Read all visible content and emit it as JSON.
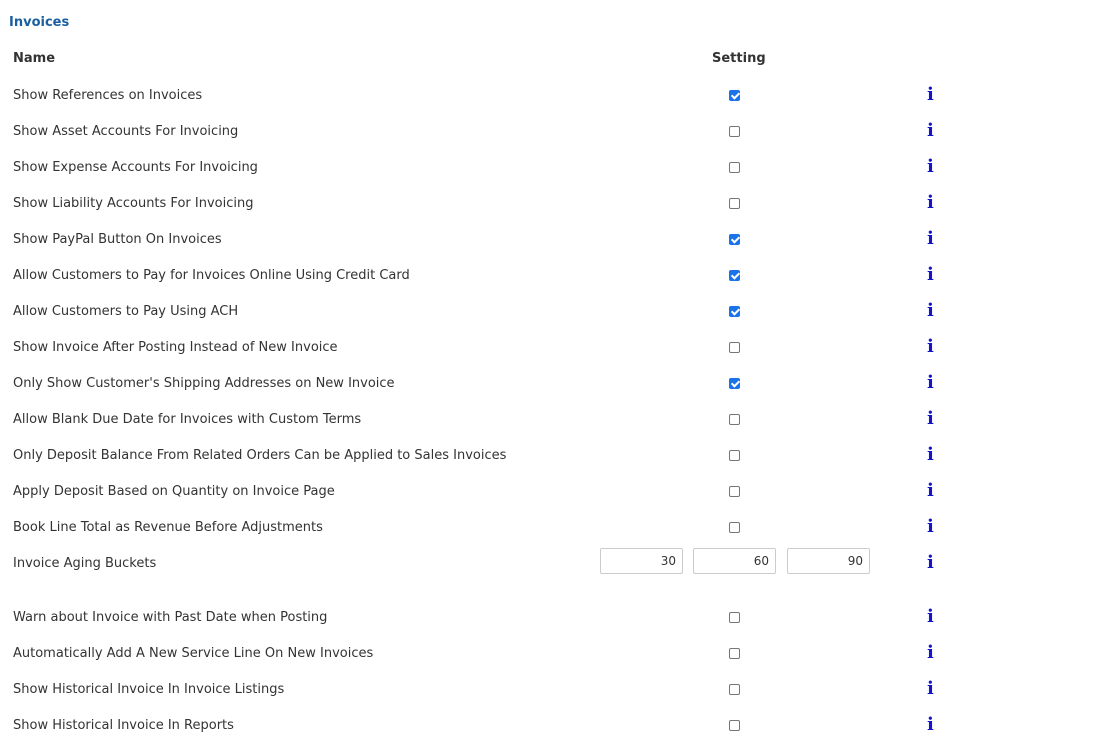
{
  "section": {
    "title": "Invoices"
  },
  "table": {
    "name_header": "Name",
    "setting_header": "Setting"
  },
  "rows": [
    {
      "label": "Show References on Invoices",
      "checked": true
    },
    {
      "label": "Show Asset Accounts For Invoicing",
      "checked": false
    },
    {
      "label": "Show Expense Accounts For Invoicing",
      "checked": false
    },
    {
      "label": "Show Liability Accounts For Invoicing",
      "checked": false
    },
    {
      "label": "Show PayPal Button On Invoices",
      "checked": true
    },
    {
      "label": "Allow Customers to Pay for Invoices Online Using Credit Card",
      "checked": true
    },
    {
      "label": "Allow Customers to Pay Using ACH",
      "checked": true
    },
    {
      "label": "Show Invoice After Posting Instead of New Invoice",
      "checked": false
    },
    {
      "label": "Only Show Customer's Shipping Addresses on New Invoice",
      "checked": true
    },
    {
      "label": "Allow Blank Due Date for Invoices with Custom Terms",
      "checked": false
    },
    {
      "label": "Only Deposit Balance From Related Orders Can be Applied to Sales Invoices",
      "checked": false
    },
    {
      "label": "Apply Deposit Based on Quantity on Invoice Page",
      "checked": false
    },
    {
      "label": "Book Line Total as Revenue Before Adjustments",
      "checked": false
    }
  ],
  "aging": {
    "label": "Invoice Aging Buckets",
    "bucket1": "30",
    "bucket2": "60",
    "bucket3": "90"
  },
  "rows2": [
    {
      "label": "Warn about Invoice with Past Date when Posting",
      "checked": false
    },
    {
      "label": "Automatically Add A New Service Line On New Invoices",
      "checked": false
    },
    {
      "label": "Show Historical Invoice In Invoice Listings",
      "checked": false
    },
    {
      "label": "Show Historical Invoice In Reports",
      "checked": false
    }
  ],
  "info_glyph": "i",
  "colors": {
    "title": "#1a5fa0",
    "info": "#1515c8",
    "checkbox_checked": "#1a73e8"
  }
}
